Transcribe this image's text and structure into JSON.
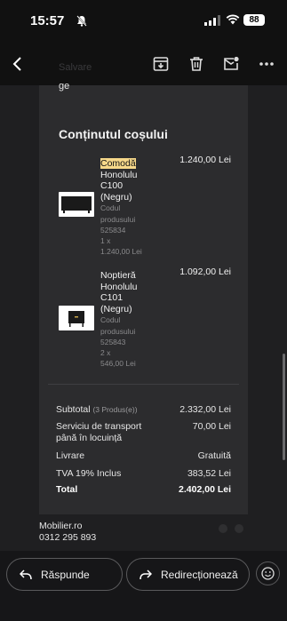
{
  "status": {
    "time": "15:57",
    "battery": "88"
  },
  "toolbar": {
    "faint_text": "Salvare"
  },
  "email": {
    "fragment": "ge",
    "cart_title": "Conținutul coșului",
    "products": [
      {
        "name_highlight": "Comodă",
        "name_rest": "Honolulu C100 (Negru)",
        "code_label": "Codul produsului",
        "code": "525834",
        "qty_line": "1 x",
        "unit_price": "1.240,00 Lei",
        "price": "1.240,00 Lei"
      },
      {
        "name": "Noptieră Honolulu C101 (Negru)",
        "code_label": "Codul produsului",
        "code": "525843",
        "qty_line": "2 x",
        "unit_price": "546,00 Lei",
        "price": "1.092,00 Lei"
      }
    ],
    "summary": {
      "subtotal_label": "Subtotal",
      "subtotal_count": "(3 Produs(e))",
      "subtotal_value": "2.332,00 Lei",
      "transport_label": "Serviciu de transport până în locuință",
      "transport_value": "70,00 Lei",
      "delivery_label": "Livrare",
      "delivery_value": "Gratuită",
      "vat_label": "TVA 19% Inclus",
      "vat_value": "383,52 Lei",
      "total_label": "Total",
      "total_value": "2.402,00 Lei"
    },
    "footer": {
      "company": "Mobilier.ro",
      "phone": "0312 295 893"
    }
  },
  "actions": {
    "reply_label": "Răspunde",
    "forward_label": "Redirecționează"
  },
  "icons": [
    "back-arrow-icon",
    "archive-icon",
    "trash-icon",
    "mark-unread-icon",
    "more-icon",
    "reply-icon",
    "forward-icon",
    "emoji-icon"
  ]
}
